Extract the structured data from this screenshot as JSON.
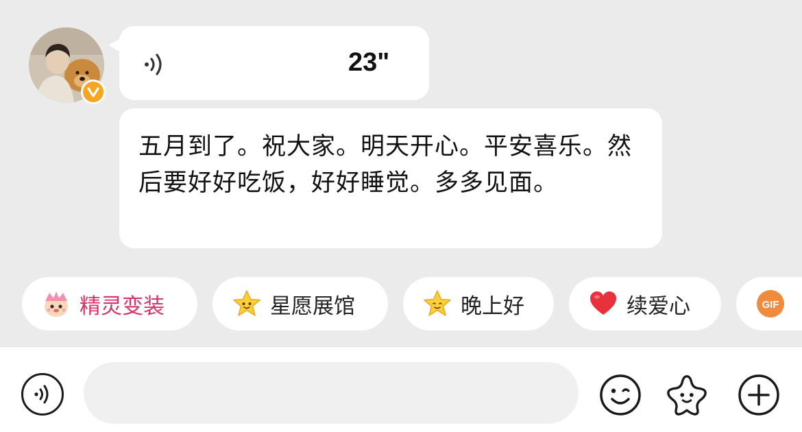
{
  "conversation": {
    "voice_message": {
      "duration": "23\""
    },
    "text_message": {
      "text": "五月到了。祝大家。明天开心。平安喜乐。然后要好好吃饭，好好睡觉。多多见面。"
    }
  },
  "quick_chips": [
    {
      "icon": "fairy-mascot-icon",
      "label": "精灵变装",
      "highlight": true
    },
    {
      "icon": "star-face-icon",
      "label": "星愿展馆",
      "highlight": false
    },
    {
      "icon": "star-face-icon",
      "label": "晚上好",
      "highlight": false
    },
    {
      "icon": "heart-icon",
      "label": "续爱心",
      "highlight": false
    },
    {
      "icon": "gif-icon",
      "label": "GIF",
      "highlight": false
    }
  ],
  "input_bar": {
    "placeholder": "",
    "voice_button": "voice-icon",
    "emoji_button": "emoji-icon",
    "sticker_button": "sticker-star-icon",
    "plus_button": "plus-icon"
  },
  "colors": {
    "chat_background": "#ebebeb",
    "bubble": "#ffffff",
    "highlight_chip_text": "#d8326b",
    "verified_badge": "#f5a623",
    "heart": "#e8313b"
  }
}
